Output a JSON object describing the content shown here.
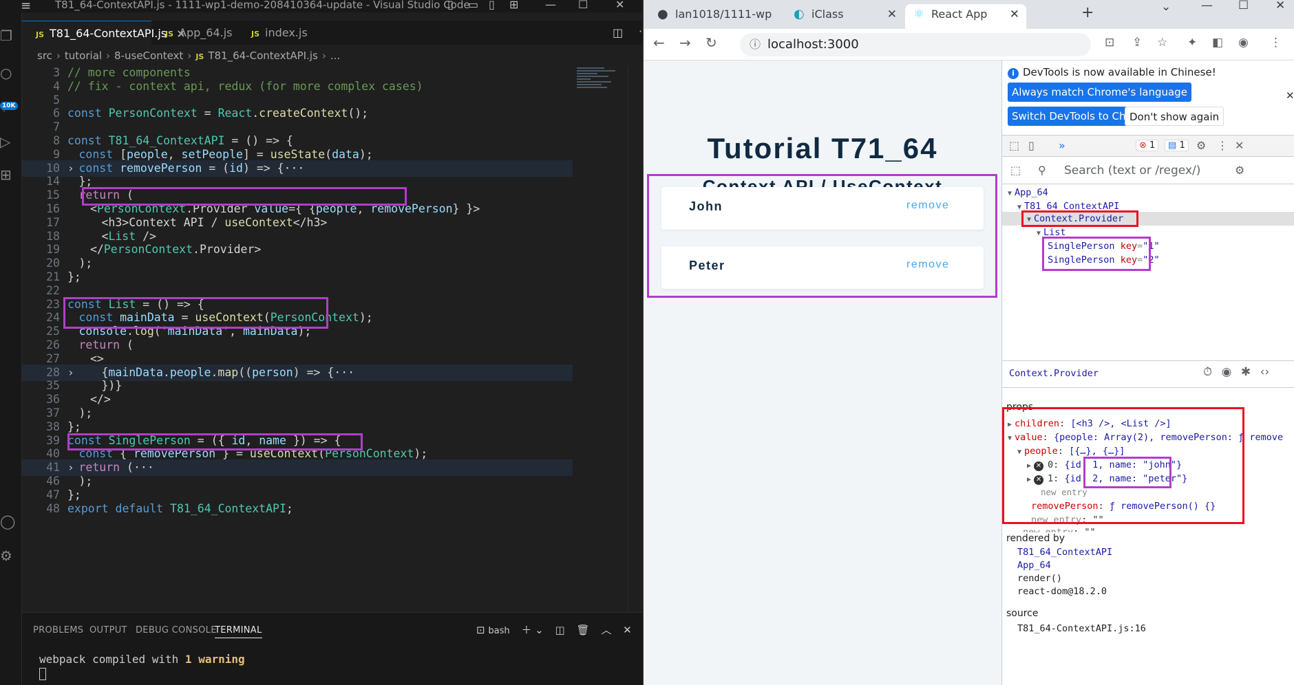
{
  "vscode": {
    "title": "T81_64-ContextAPI.js - 1111-wp1-demo-208410364-update - Visual Studio Code",
    "activity_badge": "10K",
    "tabs": [
      {
        "label": "T81_64-ContextAPI.js",
        "active": true
      },
      {
        "label": "App_64.js",
        "active": false
      },
      {
        "label": "index.js",
        "active": false
      }
    ],
    "tab_close": "×",
    "tab_js_glyph": "JS",
    "breadcrumb": [
      "src",
      "tutorial",
      "8-useContext",
      "T81_64-ContextAPI.js",
      "..."
    ],
    "breadcrumb_js": "JS",
    "lines": [
      {
        "n": "3",
        "text": "// more components"
      },
      {
        "n": "4",
        "text": "// fix - context api, redux (for more complex cases)"
      },
      {
        "n": "5",
        "text": ""
      },
      {
        "n": "6",
        "text": "const PersonContext = React.createContext();"
      },
      {
        "n": "7",
        "text": ""
      },
      {
        "n": "8",
        "text": "const T81_64_ContextAPI = () => {"
      },
      {
        "n": "9",
        "text": "const [people, setPeople] = useState(data);"
      },
      {
        "n": "10",
        "text": "const removePerson = (id) => {···"
      },
      {
        "n": "14",
        "text": "};"
      },
      {
        "n": "15",
        "text": "return ("
      },
      {
        "n": "16",
        "text": "<PersonContext.Provider value={ {people, removePerson} }>"
      },
      {
        "n": "17",
        "text": "<h3>Context API / useContext</h3>"
      },
      {
        "n": "18",
        "text": "<List />"
      },
      {
        "n": "19",
        "text": "</PersonContext.Provider>"
      },
      {
        "n": "20",
        "text": ");"
      },
      {
        "n": "21",
        "text": "};"
      },
      {
        "n": "22",
        "text": ""
      },
      {
        "n": "23",
        "text": "const List = () => {"
      },
      {
        "n": "24",
        "text": "const mainData = useContext(PersonContext);"
      },
      {
        "n": "25",
        "text": "console.log('mainData', mainData);"
      },
      {
        "n": "26",
        "text": "return ("
      },
      {
        "n": "27",
        "text": "<>"
      },
      {
        "n": "28",
        "text": "{mainData.people.map((person) => {···"
      },
      {
        "n": "35",
        "text": "})}"
      },
      {
        "n": "36",
        "text": "</>"
      },
      {
        "n": "37",
        "text": ");"
      },
      {
        "n": "38",
        "text": "};"
      },
      {
        "n": "39",
        "text": "const SinglePerson = ({ id, name }) => {"
      },
      {
        "n": "40",
        "text": "const { removePerson } = useContext(PersonContext);"
      },
      {
        "n": "41",
        "text": "return (···"
      },
      {
        "n": "46",
        "text": ");"
      },
      {
        "n": "47",
        "text": "};"
      },
      {
        "n": "48",
        "text": "export default T81_64_ContextAPI;"
      }
    ],
    "panel_tabs": [
      "PROBLEMS",
      "OUTPUT",
      "DEBUG CONSOLE",
      "TERMINAL"
    ],
    "terminal_shell": "bash",
    "terminal_prefix": "webpack compiled with ",
    "terminal_warning": "1 warning"
  },
  "chrome": {
    "tabs": [
      {
        "label": "lan1018/1111-wp",
        "icon": "github-icon"
      },
      {
        "label": "iClass",
        "icon": "iclass-icon"
      },
      {
        "label": "React App",
        "icon": "react-icon",
        "active": true
      }
    ],
    "url": "localhost:3000",
    "page": {
      "title": "Tutorial T71_64",
      "subtitle": "Context API / UseContext",
      "people": [
        {
          "name": "John",
          "action": "remove"
        },
        {
          "name": "Peter",
          "action": "remove"
        }
      ]
    },
    "devtools": {
      "info": "DevTools is now available in Chinese!",
      "btn_match": "Always match Chrome's language",
      "btn_switch": "Switch DevTools to Chinese",
      "btn_dont": "Don't show again",
      "errors": "1",
      "messages": "1",
      "search_placeholder": "Search (text or /regex/)",
      "tree": {
        "app": "App_64",
        "ctx": "T81_64_ContextAPI",
        "provider": "Context.Provider",
        "list": "List",
        "sp": "SinglePerson",
        "key_attr": "key",
        "key1": "\"1\"",
        "key2": "\"2\""
      },
      "selected": "Context.Provider",
      "props_label": "props",
      "props": {
        "children_k": "children",
        "children_v": "[<h3 />, <List />]",
        "value_k": "value",
        "value_v": "{people: Array(2), removePerson: ƒ remove",
        "people_k": "people",
        "people_v": "[{…}, {…}]",
        "p0_idx": "0",
        "p0_pre": "{id: ",
        "p0_hl": "1, name: \"john\"}",
        "p1_idx": "1",
        "p1_pre": "{id: ",
        "p1_hl": "2, name: \"peter\"}",
        "new_entry": "new entry",
        "remove_k": "removePerson",
        "remove_v": "ƒ removePerson() {}",
        "new_entry2": "new entry",
        "new_entry2_v": "\"\"",
        "new_entry3": "new entry",
        "new_entry3_v": "\"\""
      },
      "rendered_label": "rendered by",
      "rendered": [
        "T81_64_ContextAPI",
        "App_64",
        "render()",
        "react-dom@18.2.0"
      ],
      "source_label": "source",
      "source_value": "T81_64-ContextAPI.js:16"
    }
  },
  "colors": {
    "annotation_purple": "#b13ec9",
    "annotation_red": "#e81123",
    "link_blue": "#49a6e9"
  }
}
